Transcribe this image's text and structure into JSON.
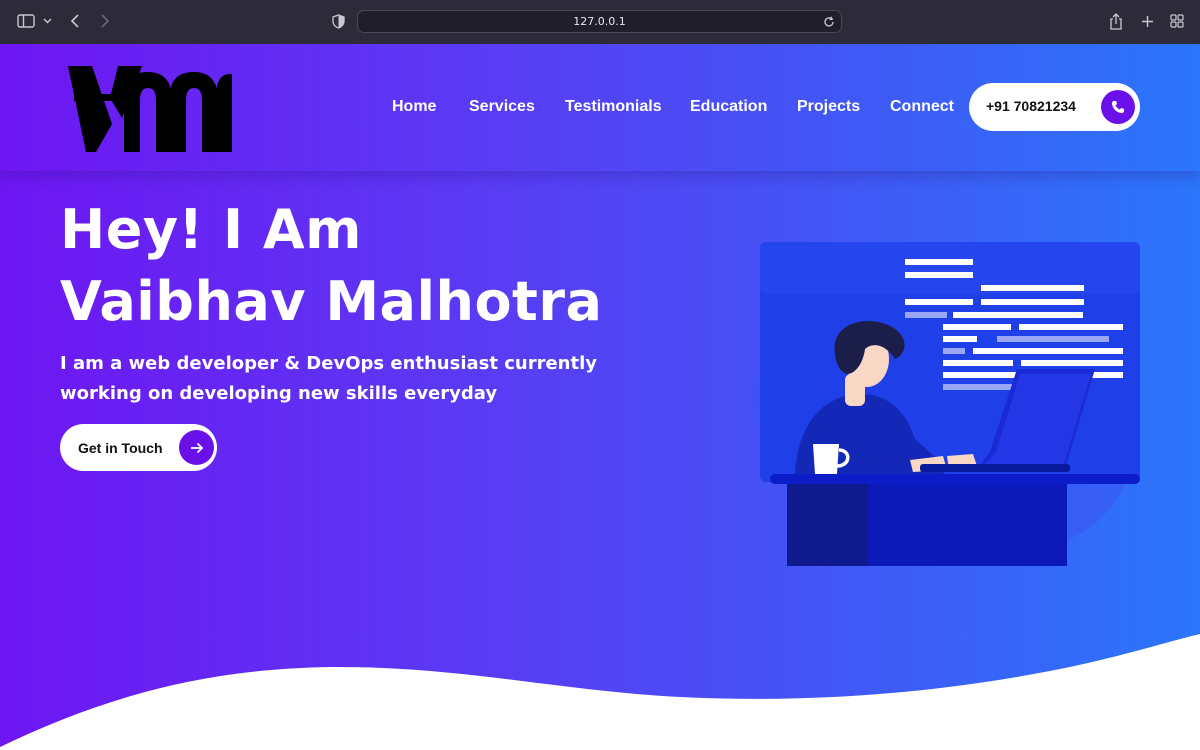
{
  "browser": {
    "url": "127.0.0.1",
    "icons": [
      "sidebar-icon",
      "chevron-down-icon",
      "back-icon",
      "forward-icon",
      "shield-icon",
      "reload-icon",
      "share-icon",
      "new-tab-icon",
      "tab-overview-icon"
    ]
  },
  "header": {
    "logo": "VM",
    "nav": [
      "Home",
      "Services",
      "Testimonials",
      "Education",
      "Projects",
      "Connect"
    ],
    "phone": "+91 70821234",
    "phone_icon": "phone-icon"
  },
  "hero": {
    "title_line1": "Hey! I Am",
    "title_line2": "Vaibhav Malhotra",
    "subtitle": "I am a web developer & DevOps enthusiast currently working on developing new skills everyday",
    "cta_label": "Get in Touch",
    "cta_icon": "arrow-right-icon",
    "illustration": "developer-at-laptop-illustration"
  },
  "colors": {
    "gradient_start": "#6e16f2",
    "gradient_end": "#2b76fb",
    "accent": "#6a10e8"
  }
}
